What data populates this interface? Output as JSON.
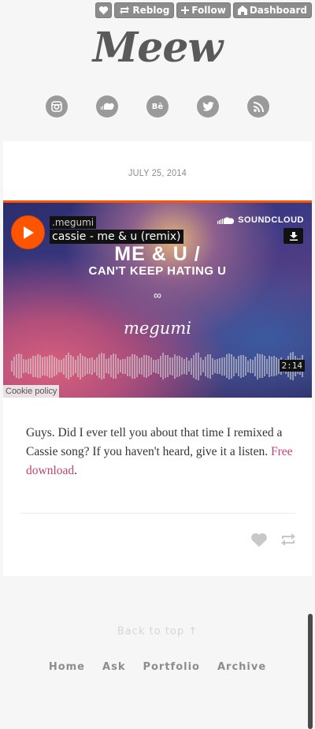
{
  "tumblr_controls": {
    "like_icon": "heart-icon",
    "reblog_label": "Reblog",
    "follow_label": "Follow",
    "dashboard_label": "Dashboard"
  },
  "blog": {
    "title": "Meew"
  },
  "social_links": [
    "instagram-icon",
    "soundcloud-icon",
    "behance-icon",
    "twitter-icon",
    "rss-icon"
  ],
  "post": {
    "date": "JULY 25, 2014",
    "player": {
      "user": ".megumi",
      "track_title": "cassie - me & u (remix)",
      "brand": "SOUNDCLOUD",
      "artwork_title": "ME & U /",
      "artwork_subtitle": "CAN'T KEEP HATING U",
      "artwork_symbol": "∞",
      "artwork_artist": "megumi",
      "duration": "2:14",
      "cookie_label": "Cookie policy",
      "accent_color": "#ff5500"
    },
    "body_text": "Guys. Did I ever tell you about that time I remixed a Cassie song? If you haven't heard, give it a listen. ",
    "link_text": "Free download",
    "body_end": "."
  },
  "footer": {
    "back_to_top": "Back to top ↑",
    "nav": [
      "Home",
      "Ask",
      "Portfolio",
      "Archive"
    ]
  },
  "colors": {
    "link": "#c2426e",
    "icon_gray": "#9a9a9a"
  }
}
